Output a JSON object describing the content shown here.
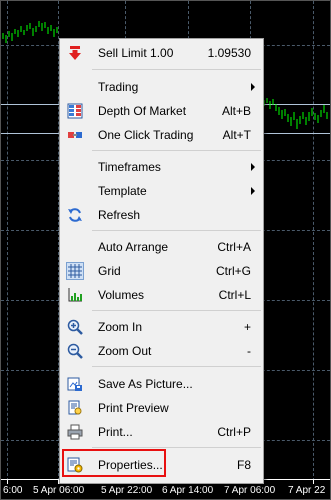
{
  "axis": {
    "labels": [
      "6:00",
      "5 Apr 06:00",
      "5 Apr 22:00",
      "6 Apr 14:00",
      "7 Apr 06:00",
      "7 Apr 22"
    ]
  },
  "menu": {
    "items": [
      {
        "label": "Sell Limit 1.00",
        "shortcut": "1.09530",
        "icon": "sell-limit-arrow-icon"
      },
      {
        "label": "Trading",
        "shortcut": "",
        "submenu": true
      },
      {
        "label": "Depth Of Market",
        "shortcut": "Alt+B",
        "icon": "depth-of-market-icon"
      },
      {
        "label": "One Click Trading",
        "shortcut": "Alt+T",
        "icon": "one-click-trading-icon"
      },
      {
        "label": "Timeframes",
        "shortcut": "",
        "submenu": true
      },
      {
        "label": "Template",
        "shortcut": "",
        "submenu": true
      },
      {
        "label": "Refresh",
        "shortcut": "",
        "icon": "refresh-icon"
      },
      {
        "label": "Auto Arrange",
        "shortcut": "Ctrl+A"
      },
      {
        "label": "Grid",
        "shortcut": "Ctrl+G",
        "icon": "grid-icon"
      },
      {
        "label": "Volumes",
        "shortcut": "Ctrl+L",
        "icon": "volumes-icon"
      },
      {
        "label": "Zoom In",
        "shortcut": "+",
        "icon": "zoom-in-icon"
      },
      {
        "label": "Zoom Out",
        "shortcut": "-",
        "icon": "zoom-out-icon"
      },
      {
        "label": "Save As Picture...",
        "shortcut": "",
        "icon": "save-picture-icon"
      },
      {
        "label": "Print Preview",
        "shortcut": "",
        "icon": "print-preview-icon"
      },
      {
        "label": "Print...",
        "shortcut": "Ctrl+P",
        "icon": "printer-icon"
      },
      {
        "label": "Properties...",
        "shortcut": "F8",
        "icon": "properties-icon"
      }
    ]
  },
  "colors": {
    "chart_background": "#000000",
    "candles": "#00ff00",
    "highlight": "#e81010"
  }
}
